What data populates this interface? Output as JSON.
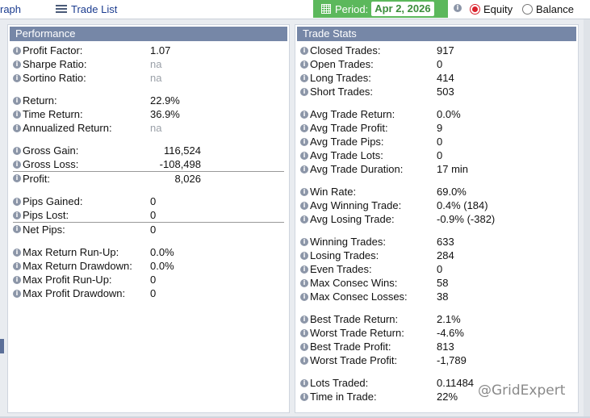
{
  "topbar": {
    "graph_tab": "raph",
    "trade_list_tab": "Trade List",
    "period_label": "Period:",
    "period_value": "Apr 2, 2026",
    "equity_label": "Equity",
    "balance_label": "Balance",
    "selected_mode": "Equity"
  },
  "performance": {
    "title": "Performance",
    "rows": [
      {
        "label": "Profit Factor:",
        "value": "1.07"
      },
      {
        "label": "Sharpe Ratio:",
        "value": "na"
      },
      {
        "label": "Sortino Ratio:",
        "value": "na"
      },
      {
        "label": "Return:",
        "value": "22.9%"
      },
      {
        "label": "Time Return:",
        "value": "36.9%"
      },
      {
        "label": "Annualized Return:",
        "value": "na"
      },
      {
        "label": "Gross Gain:",
        "value": "116,524"
      },
      {
        "label": "Gross Loss:",
        "value": "-108,498"
      },
      {
        "label": "Profit:",
        "value": "8,026"
      },
      {
        "label": "Pips Gained:",
        "value": "0"
      },
      {
        "label": "Pips Lost:",
        "value": "0"
      },
      {
        "label": "Net Pips:",
        "value": "0"
      },
      {
        "label": "Max Return Run-Up:",
        "value": "0.0%"
      },
      {
        "label": "Max Return Drawdown:",
        "value": "0.0%"
      },
      {
        "label": "Max Profit Run-Up:",
        "value": "0"
      },
      {
        "label": "Max Profit Drawdown:",
        "value": "0"
      }
    ]
  },
  "trade_stats": {
    "title": "Trade Stats",
    "rows": [
      {
        "label": "Closed Trades:",
        "value": "917"
      },
      {
        "label": "Open Trades:",
        "value": "0"
      },
      {
        "label": "Long Trades:",
        "value": "414"
      },
      {
        "label": "Short Trades:",
        "value": "503"
      },
      {
        "label": "Avg Trade Return:",
        "value": "0.0%"
      },
      {
        "label": "Avg Trade Profit:",
        "value": "9"
      },
      {
        "label": "Avg Trade Pips:",
        "value": "0"
      },
      {
        "label": "Avg Trade Lots:",
        "value": "0"
      },
      {
        "label": "Avg Trade Duration:",
        "value": "17 min"
      },
      {
        "label": "Win Rate:",
        "value": "69.0%"
      },
      {
        "label": "Avg Winning Trade:",
        "value": "0.4% (184)"
      },
      {
        "label": "Avg Losing Trade:",
        "value": "-0.9% (-382)"
      },
      {
        "label": "Winning Trades:",
        "value": "633"
      },
      {
        "label": "Losing Trades:",
        "value": "284"
      },
      {
        "label": "Even Trades:",
        "value": "0"
      },
      {
        "label": "Max Consec Wins:",
        "value": "58"
      },
      {
        "label": "Max Consec Losses:",
        "value": "38"
      },
      {
        "label": "Best Trade Return:",
        "value": "2.1%"
      },
      {
        "label": "Worst Trade Return:",
        "value": "-4.6%"
      },
      {
        "label": "Best Trade Profit:",
        "value": "813"
      },
      {
        "label": "Worst Trade Profit:",
        "value": "-1,789"
      },
      {
        "label": "Lots Traded:",
        "value": "0.11484"
      },
      {
        "label": "Time in Trade:",
        "value": "22%"
      }
    ]
  },
  "watermark": "@GridExpert",
  "colors": {
    "panel_header": "#7687a7",
    "period_green": "#5cb85c",
    "radio_selected": "#d9212c",
    "na_text": "#9aa0a8"
  }
}
